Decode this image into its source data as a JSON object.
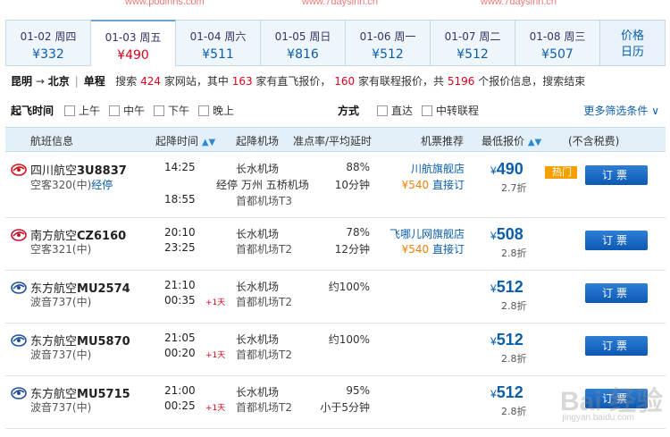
{
  "watermarks": [
    "www.podinns.com",
    "www.7daysinn.cn",
    "www.7daysinn.cn"
  ],
  "dates": [
    {
      "date": "01-02 周四",
      "price": "¥332"
    },
    {
      "date": "01-03 周五",
      "price": "¥490"
    },
    {
      "date": "01-04 周六",
      "price": "¥511"
    },
    {
      "date": "01-05 周日",
      "price": "¥816"
    },
    {
      "date": "01-06 周一",
      "price": "¥512"
    },
    {
      "date": "01-07 周二",
      "price": "¥512"
    },
    {
      "date": "01-08 周三",
      "price": "¥507"
    }
  ],
  "calendar_tab": {
    "line1": "价格",
    "line2": "日历"
  },
  "summary": {
    "route": "昆明",
    "arrow": "→",
    "dest": "北京",
    "trip_type": "单程",
    "t1": "搜索",
    "sites": "424",
    "t2": "家网站，其中",
    "direct": "163",
    "t3": "家有直飞报价，",
    "conn": "160",
    "t4": "家有联程报价，共",
    "total": "5196",
    "t5": "个报价信息，搜索结束"
  },
  "filters": {
    "time_label": "起飞时间",
    "time_opts": [
      "上午",
      "中午",
      "下午",
      "晚上"
    ],
    "mode_label": "方式",
    "mode_opts": [
      "直达",
      "中转联程"
    ],
    "more": "更多筛选条件 ∨"
  },
  "header": {
    "flight": "航班信息",
    "time": "起降时间",
    "airport": "起降机场",
    "ontime": "准点率/平均延时",
    "agent": "机票推荐",
    "price": "最低报价",
    "tax": "(不含税费)",
    "sort": "▲▼"
  },
  "flights": [
    {
      "airline": "四川航空",
      "code": "3U8837",
      "plane": "空客320(中)",
      "stop_label": "经停",
      "dep": "14:25",
      "stop": "经停",
      "arr": "18:55",
      "plus": "",
      "apt_dep": "长水机场",
      "apt_stop": "万州 五桥机场",
      "apt_arr": "首都机场T3",
      "rate": "88%",
      "delay": "10分钟",
      "agent": "川航旗舰店",
      "agent2_price": "¥540",
      "agent2": "直接订",
      "price": "490",
      "disc": "2.7折",
      "hot": "热门",
      "book": "订票",
      "logo_color": "#d1121a"
    },
    {
      "airline": "南方航空",
      "code": "CZ6160",
      "plane": "空客321(中)",
      "dep": "20:10",
      "arr": "23:25",
      "plus": "",
      "apt_dep": "长水机场",
      "apt_arr": "首都机场T2",
      "rate": "78%",
      "delay": "12分钟",
      "agent": "飞哪儿网旗舰店",
      "agent2_price": "¥540",
      "agent2": "直接订",
      "price": "508",
      "disc": "2.8折",
      "book": "订票",
      "logo_color": "#c8102e"
    },
    {
      "airline": "东方航空",
      "code": "MU2574",
      "plane": "波音737(中)",
      "dep": "21:10",
      "arr": "00:35",
      "plus": "+1天",
      "apt_dep": "长水机场",
      "apt_arr": "首都机场T2",
      "rate": "约100%",
      "delay": "",
      "price": "512",
      "disc": "2.8折",
      "book": "订票",
      "logo_color": "#1f4e9c"
    },
    {
      "airline": "东方航空",
      "code": "MU5870",
      "plane": "波音737(中)",
      "dep": "21:05",
      "arr": "00:20",
      "plus": "+1天",
      "apt_dep": "长水机场",
      "apt_arr": "首都机场T2",
      "rate": "约100%",
      "delay": "",
      "price": "512",
      "disc": "2.8折",
      "book": "订票",
      "logo_color": "#1f4e9c"
    },
    {
      "airline": "东方航空",
      "code": "MU5715",
      "plane": "波音737(中)",
      "dep": "21:00",
      "arr": "00:25",
      "plus": "+1天",
      "apt_dep": "长水机场",
      "apt_arr": "首都机场T2",
      "rate": "95%",
      "delay": "小于5分钟",
      "price": "512",
      "disc": "2.8折",
      "book": "订票",
      "logo_color": "#1f4e9c"
    }
  ],
  "currency": "¥",
  "watermark_bottom": "Bai 经验",
  "watermark_bottom_sub": "jingyan.baidu.com"
}
